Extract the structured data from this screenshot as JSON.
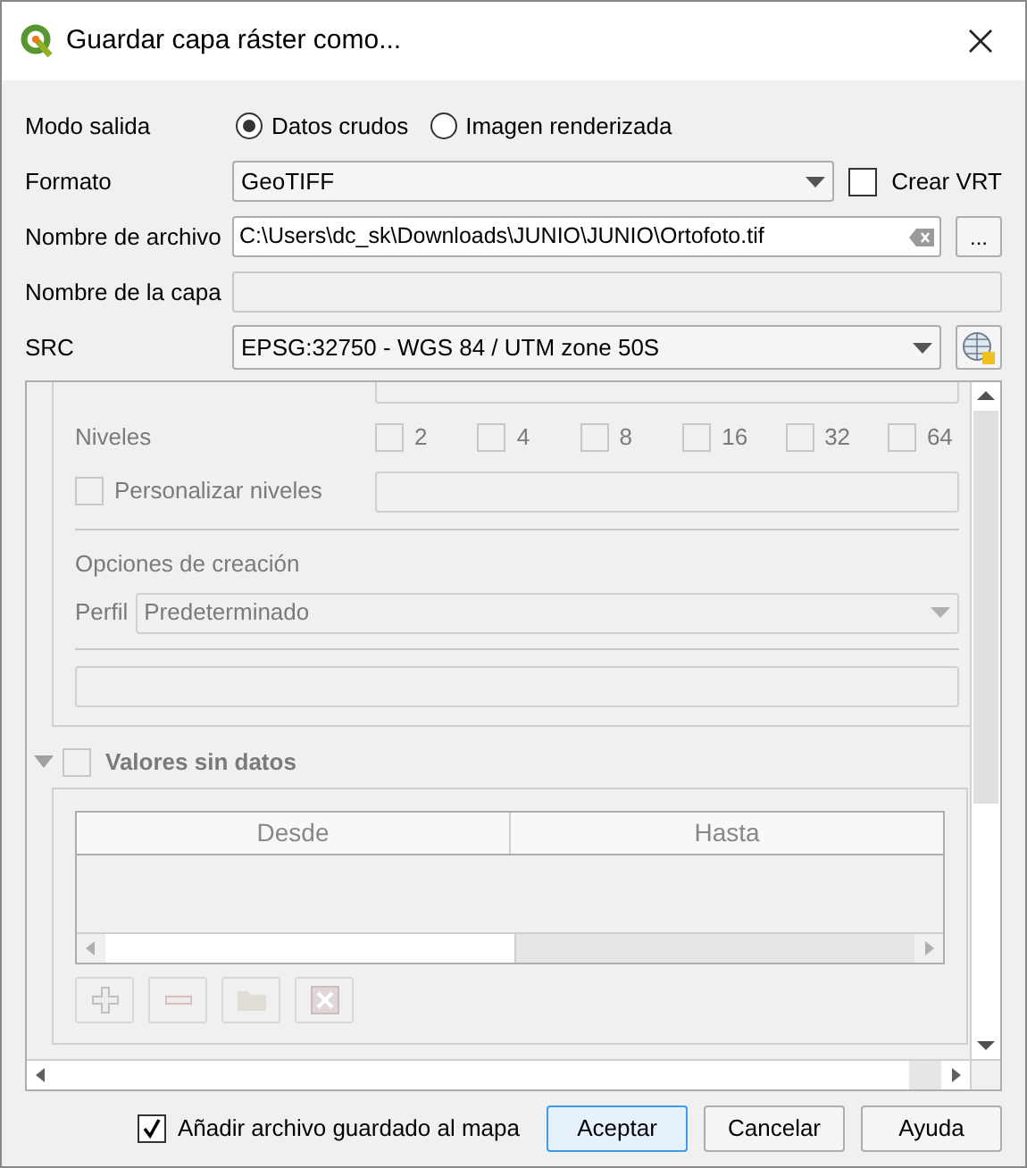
{
  "window": {
    "title": "Guardar capa ráster como..."
  },
  "output_mode": {
    "label": "Modo salida",
    "options": [
      {
        "label": "Datos crudos",
        "selected": true
      },
      {
        "label": "Imagen renderizada",
        "selected": false
      }
    ]
  },
  "format": {
    "label": "Formato",
    "value": "GeoTIFF",
    "vrt": {
      "label": "Crear VRT",
      "checked": false
    }
  },
  "file_name": {
    "label": "Nombre de archivo",
    "value": "C:\\Users\\dc_sk\\Downloads\\JUNIO\\JUNIO\\Ortofoto.tif",
    "browse": "..."
  },
  "layer_name": {
    "label": "Nombre de la capa"
  },
  "crs": {
    "label": "SRC",
    "value": "EPSG:32750 - WGS 84 / UTM zone 50S"
  },
  "pyramids": {
    "label": "Niveles",
    "levels": [
      {
        "label": "2",
        "checked": false
      },
      {
        "label": "4",
        "checked": false
      },
      {
        "label": "8",
        "checked": false
      },
      {
        "label": "16",
        "checked": false
      },
      {
        "label": "32",
        "checked": false
      },
      {
        "label": "64",
        "checked": false
      }
    ]
  },
  "custom_levels": {
    "label": "Personalizar niveles",
    "checked": false
  },
  "creation_options": {
    "title": "Opciones de creación",
    "profile_label": "Perfil",
    "profile": "Predeterminado"
  },
  "nodata": {
    "title": "Valores sin datos",
    "checked": false,
    "expanded": true,
    "columns": [
      "Desde",
      "Hasta"
    ]
  },
  "add_to_map": {
    "label": "Añadir archivo guardado al mapa",
    "checked": true
  },
  "buttons": [
    {
      "label": "Aceptar",
      "default": true
    },
    {
      "label": "Cancelar",
      "default": false
    },
    {
      "label": "Ayuda",
      "default": false
    }
  ]
}
